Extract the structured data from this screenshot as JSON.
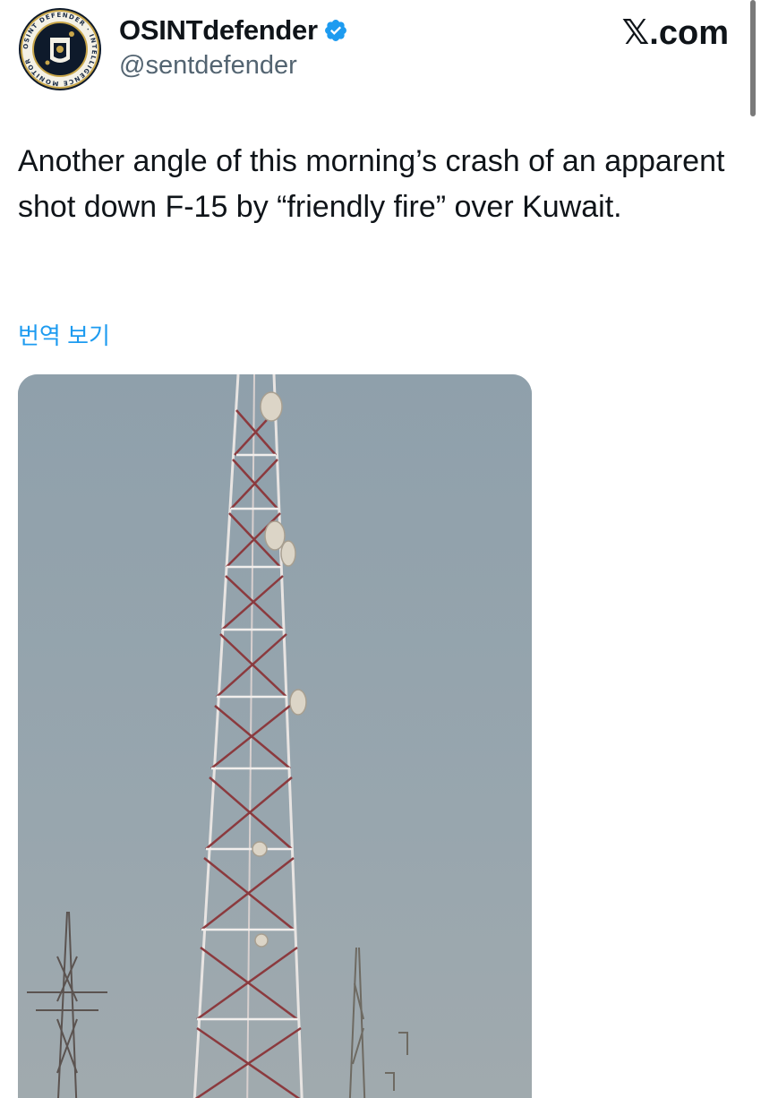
{
  "author": {
    "display_name": "OSINTdefender",
    "handle": "@sentdefender",
    "verified": true,
    "avatar_icon": "osint-defender-seal-icon",
    "avatar_seal_text": "OSINT DEFENDER · INTELLIGENCE MONITOR"
  },
  "brand": {
    "logo_icon": "x-logo-icon",
    "x_glyph": "𝕏",
    "suffix": ".com"
  },
  "tweet": {
    "text": "Another angle of this morning’s crash of an apparent shot down F-15 by “friendly fire” over Kuwait.",
    "translate_label": "번역 보기"
  },
  "media": {
    "type": "video-frame",
    "alt_icon": "tower-video-thumbnail"
  },
  "colors": {
    "text": "#0f1419",
    "secondary": "#536471",
    "link": "#1d9bf0",
    "verified": "#1d9bf0",
    "sky": "#96a4ad"
  }
}
